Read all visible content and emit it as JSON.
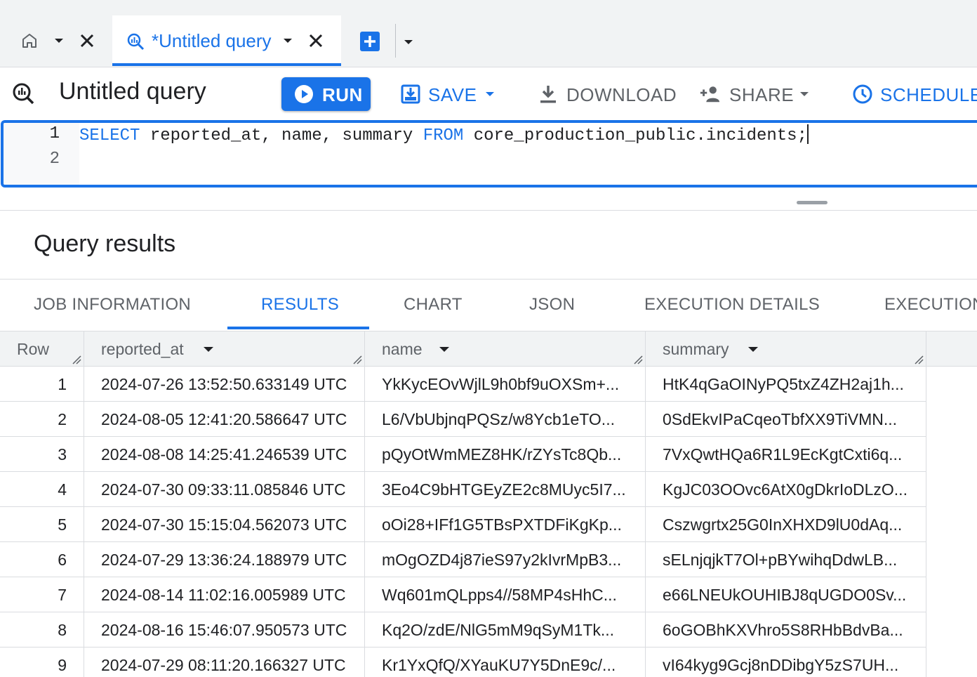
{
  "tabs": {
    "home_tab": {
      "icon": "home-icon"
    },
    "active_tab": {
      "label": "*Untitled query",
      "icon": "query-icon"
    }
  },
  "toolbar": {
    "title": "Untitled query",
    "run_label": "RUN",
    "save_label": "SAVE",
    "download_label": "DOWNLOAD",
    "share_label": "SHARE",
    "schedule_label": "SCHEDULE"
  },
  "editor": {
    "line_numbers": [
      "1",
      "2"
    ],
    "kw_select": "SELECT",
    "columns": " reported_at, name, summary ",
    "kw_from": "FROM",
    "table": " core_production_public.incidents;"
  },
  "results": {
    "title": "Query results",
    "tabs": [
      "JOB INFORMATION",
      "RESULTS",
      "CHART",
      "JSON",
      "EXECUTION DETAILS",
      "EXECUTION GRAPH"
    ],
    "active_tab": "RESULTS",
    "columns": [
      "Row",
      "reported_at",
      "name",
      "summary"
    ],
    "rows": [
      {
        "row": "1",
        "reported_at": "2024-07-26 13:52:50.633149 UTC",
        "name": "YkKycEOvWjlL9h0bf9uOXSm+...",
        "summary": "HtK4qGaOINyPQ5txZ4ZH2aj1h..."
      },
      {
        "row": "2",
        "reported_at": "2024-08-05 12:41:20.586647 UTC",
        "name": "L6/VbUbjnqPQSz/w8Ycb1eTO...",
        "summary": "0SdEkvIPaCqeoTbfXX9TiVMN..."
      },
      {
        "row": "3",
        "reported_at": "2024-08-08 14:25:41.246539 UTC",
        "name": "pQyOtWmMEZ8HK/rZYsTc8Qb...",
        "summary": "7VxQwtHQa6R1L9EcKgtCxti6q..."
      },
      {
        "row": "4",
        "reported_at": "2024-07-30 09:33:11.085846 UTC",
        "name": "3Eo4C9bHTGEyZE2c8MUyc5I7...",
        "summary": "KgJC03OOvc6AtX0gDkrIoDLzO..."
      },
      {
        "row": "5",
        "reported_at": "2024-07-30 15:15:04.562073 UTC",
        "name": "oOi28+IFf1G5TBsPXTDFiKgKp...",
        "summary": "Cszwgrtx25G0InXHXD9lU0dAq..."
      },
      {
        "row": "6",
        "reported_at": "2024-07-29 13:36:24.188979 UTC",
        "name": "mOgOZD4j87ieS97y2kIvrMpB3...",
        "summary": "sELnjqjkT7Ol+pBYwihqDdwLB..."
      },
      {
        "row": "7",
        "reported_at": "2024-08-14 11:02:16.005989 UTC",
        "name": "Wq601mQLpps4//58MP4sHhC...",
        "summary": "e66LNEUkOUHIBJ8qUGDO0Sv..."
      },
      {
        "row": "8",
        "reported_at": "2024-08-16 15:46:07.950573 UTC",
        "name": "Kq2O/zdE/NlG5mM9qSyM1Tk...",
        "summary": "6oGOBhKXVhro5S8RHbBdvBa..."
      },
      {
        "row": "9",
        "reported_at": "2024-07-29 08:11:20.166327 UTC",
        "name": "Kr1YxQfQ/XYauKU7Y5DnE9c/...",
        "summary": "vI64kyg9Gcj8nDDibgY5zS7UH..."
      }
    ]
  },
  "colors": {
    "accent": "#1a73e8",
    "tabstrip_bg": "#f1f3f4",
    "muted_text": "#5f6368",
    "border": "#dadce0"
  }
}
